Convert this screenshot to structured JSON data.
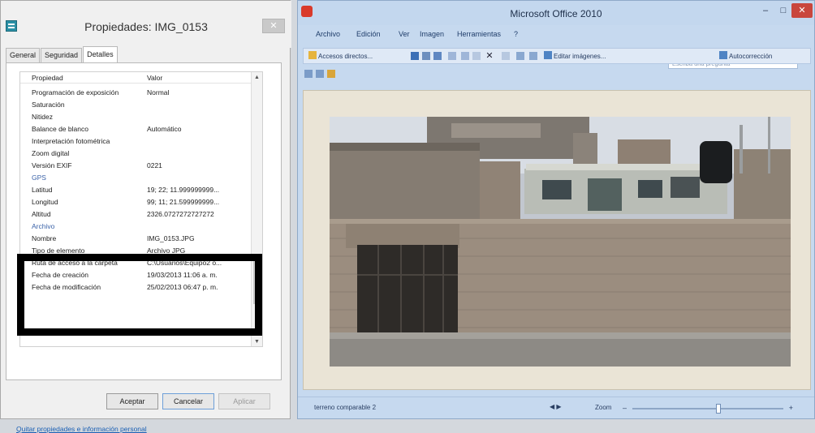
{
  "dialog": {
    "title": "Propiedades: IMG_0153",
    "close_glyph": "✕",
    "tabs": [
      {
        "label": "General",
        "active": false
      },
      {
        "label": "Seguridad",
        "active": false
      },
      {
        "label": "Detalles",
        "active": true
      }
    ],
    "list_header": {
      "name": "Propiedad",
      "value": "Valor"
    },
    "rows": [
      {
        "name": "Programación de exposición",
        "value": "Normal"
      },
      {
        "name": "Saturación",
        "value": ""
      },
      {
        "name": "Nitidez",
        "value": ""
      },
      {
        "name": "Balance de blanco",
        "value": "Automático"
      },
      {
        "name": "Interpretación fotométrica",
        "value": ""
      },
      {
        "name": "Zoom digital",
        "value": ""
      },
      {
        "name": "Versión EXIF",
        "value": "0221"
      },
      {
        "name": "GPS",
        "value": "",
        "section": true
      },
      {
        "name": "Latitud",
        "value": "19; 22; 11.999999999..."
      },
      {
        "name": "Longitud",
        "value": "99; 11; 21.599999999..."
      },
      {
        "name": "Altitud",
        "value": "2326.0727272727272"
      },
      {
        "name": "Archivo",
        "value": "",
        "section": true
      },
      {
        "name": "Nombre",
        "value": "IMG_0153.JPG"
      },
      {
        "name": "Tipo de elemento",
        "value": "Archivo JPG"
      },
      {
        "name": "Ruta de acceso a la carpeta",
        "value": "C:\\Usuarios\\Equipo2 o..."
      },
      {
        "name": "Fecha de creación",
        "value": "19/03/2013 11:06 a. m."
      },
      {
        "name": "Fecha de modificación",
        "value": "25/02/2013 06:47 p. m."
      }
    ],
    "remove_link": "Quitar propiedades e información personal",
    "buttons": {
      "accept": "Aceptar",
      "cancel": "Cancelar",
      "apply": "Aplicar"
    }
  },
  "viewer": {
    "title": "Microsoft Office 2010",
    "window_controls": {
      "minimize": "–",
      "maximize": "□",
      "close": "✕"
    },
    "menu": [
      "Archivo",
      "Edición",
      "Ver",
      "Imagen",
      "Herramientas",
      "?"
    ],
    "ask_placeholder": "Escriba una pregunta",
    "toolbar": {
      "shortcuts": "Accesos directos...",
      "edit_images": "Editar imágenes...",
      "autocorrect": "Autocorrección"
    },
    "status": "terreno comparable 2",
    "nav_arrows": "◀  ▶",
    "zoom_label": "Zoom",
    "zoom_minus": "–",
    "zoom_plus": "+",
    "zoom_level": 0.57
  },
  "colors": {
    "accent_blue": "#1a5fb4",
    "close_red": "#c9463d",
    "highlight": "#000000"
  },
  "icons": [
    "document-icon",
    "close-icon",
    "app-icon",
    "minimize-icon",
    "maximize-icon",
    "save-icon",
    "print-icon",
    "delete-icon",
    "rotate-icon",
    "zoom-minus-icon",
    "zoom-plus-icon"
  ]
}
